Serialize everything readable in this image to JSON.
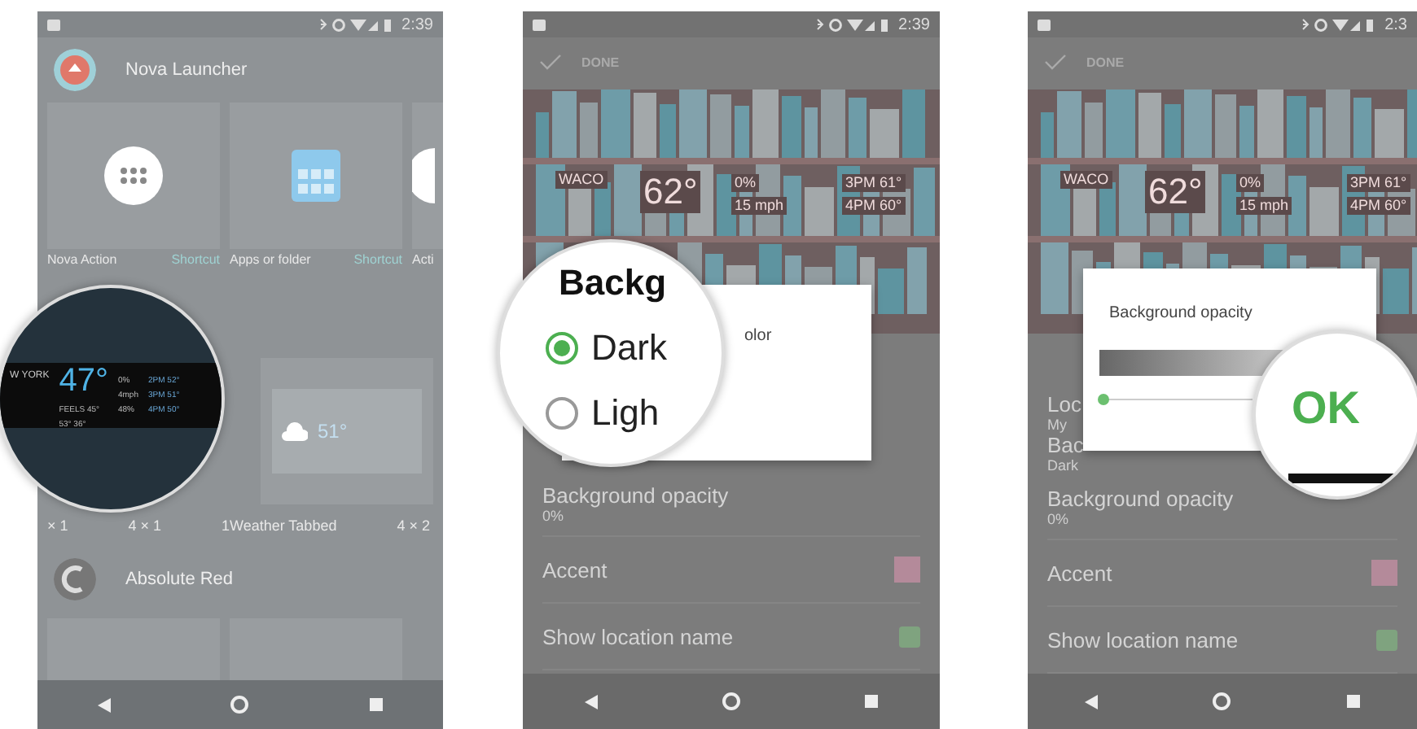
{
  "screens": [
    {
      "kind": "widgets",
      "status_time": "2:39",
      "header_1": "Nova Launcher",
      "tiles_1": [
        {
          "kind": "dots",
          "label": "Nova Action",
          "tag": "Shortcut"
        },
        {
          "kind": "grid",
          "label": "Apps or folder",
          "tag": "Shortcut"
        },
        {
          "kind": "partial",
          "label": "Acti"
        }
      ],
      "labels_2": [
        "× 1",
        "4 × 1",
        "1Weather Tabbed",
        "4 × 2"
      ],
      "preview_temp": "51°",
      "header_2": "Absolute Red",
      "magnifier": {
        "kind": "weather",
        "city": "W YORK",
        "temp": "47°",
        "feels": "FEELS 45°",
        "range": "53° 36°",
        "details": [
          "0%",
          "4mph",
          "48%"
        ],
        "hours": [
          "2PM 52°",
          "3PM 51°",
          "4PM 50°"
        ]
      }
    },
    {
      "kind": "settings",
      "status_time": "2:39",
      "action": "DONE",
      "weather": {
        "city": "WACO",
        "temp": "62°",
        "rain": "0%",
        "wind": "15 mph",
        "hour_1": "3PM 61°",
        "hour_2": "4PM 60°"
      },
      "dialog": {
        "kind": "radio",
        "title": "olor"
      },
      "magnifier": {
        "kind": "radio",
        "title": "Backg",
        "options": [
          {
            "label": "Dark",
            "selected": true
          },
          {
            "label": "Ligh",
            "selected": false
          }
        ]
      },
      "rows": [
        {
          "kind": "text",
          "title": "Background opacity",
          "sub": "0%"
        },
        {
          "kind": "swatch",
          "title": "Accent",
          "color": "#b48a9a"
        },
        {
          "kind": "check",
          "title": "Show location name",
          "checked": true
        }
      ]
    },
    {
      "kind": "settings",
      "status_time": "2:3",
      "action": "DONE",
      "weather": {
        "city": "WACO",
        "temp": "62°",
        "rain": "0%",
        "wind": "15 mph",
        "hour_1": "3PM 61°",
        "hour_2": "4PM 60°"
      },
      "dialog": {
        "kind": "slider",
        "title": "Background opacity",
        "level": 0
      },
      "magnifier": {
        "kind": "button",
        "label": "OK"
      },
      "rows": [
        {
          "kind": "text",
          "title": "Loc",
          "sub": "My"
        },
        {
          "kind": "text",
          "title": "Bac",
          "sub": "Dark"
        },
        {
          "kind": "text",
          "title": "Background opacity",
          "sub": "0%"
        },
        {
          "kind": "swatch",
          "title": "Accent",
          "color": "#b48a9a"
        },
        {
          "kind": "check",
          "title": "Show location name",
          "checked": true
        }
      ]
    }
  ]
}
